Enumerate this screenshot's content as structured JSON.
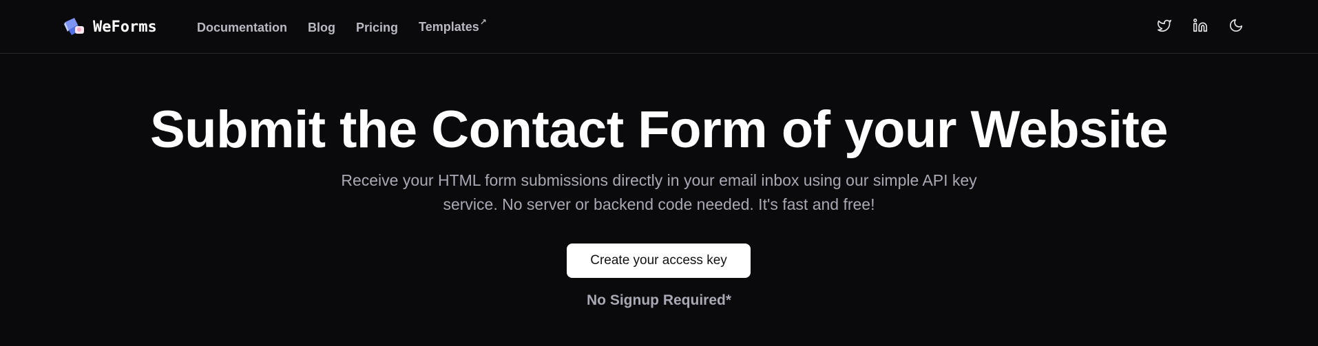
{
  "header": {
    "brand": "WeForms",
    "nav": [
      {
        "label": "Documentation"
      },
      {
        "label": "Blog"
      },
      {
        "label": "Pricing"
      },
      {
        "label": "Templates",
        "external_icon": "↗"
      }
    ],
    "social_icons": [
      "twitter-icon",
      "linkedin-icon",
      "moon-icon"
    ]
  },
  "hero": {
    "title": "Submit the Contact Form of your Website",
    "subtitle": "Receive your HTML form submissions directly in your email inbox using our simple API key service. No server or backend code needed. It's fast and free!",
    "cta_label": "Create your access key",
    "note": "No Signup Required*"
  },
  "colors": {
    "background": "#0a0a0d",
    "heading": "#ffffff",
    "muted_text": "#a9a9b4",
    "nav_text": "#b9b9c2",
    "button_bg": "#ffffff",
    "button_text": "#111114",
    "logo_blue": "#6b8cf7",
    "logo_pink": "#f3a9c2"
  }
}
